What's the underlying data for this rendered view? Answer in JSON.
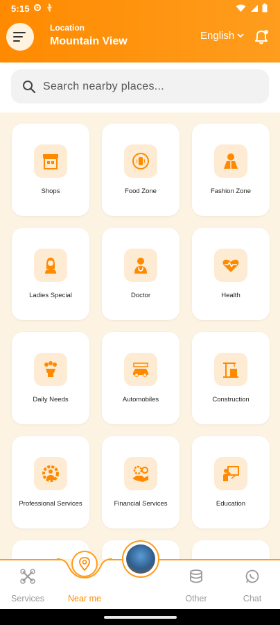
{
  "status": {
    "time": "5:15"
  },
  "header": {
    "location_label": "Location",
    "location_value": "Mountain View",
    "language": "English"
  },
  "search": {
    "placeholder": "Search nearby places..."
  },
  "categories": [
    {
      "label": "Shops",
      "icon": "shop-icon"
    },
    {
      "label": "Food Zone",
      "icon": "food-icon"
    },
    {
      "label": "Fashion Zone",
      "icon": "fashion-icon"
    },
    {
      "label": "Ladies Special",
      "icon": "ladies-icon"
    },
    {
      "label": "Doctor",
      "icon": "doctor-icon"
    },
    {
      "label": "Health",
      "icon": "health-icon"
    },
    {
      "label": "Daily Needs",
      "icon": "daily-needs-icon"
    },
    {
      "label": "Automobiles",
      "icon": "automobile-icon"
    },
    {
      "label": "Construction",
      "icon": "construction-icon"
    },
    {
      "label": "Professional Services",
      "icon": "professional-icon"
    },
    {
      "label": "Financial Services",
      "icon": "financial-icon"
    },
    {
      "label": "Education",
      "icon": "education-icon"
    }
  ],
  "bottom_nav": {
    "services": "Services",
    "near_me": "Near me",
    "other": "Other",
    "chat": "Chat"
  },
  "colors": {
    "accent": "#ff8a00",
    "card_icon_bg": "#fdebd3",
    "page_bg": "#fdf3e3"
  }
}
